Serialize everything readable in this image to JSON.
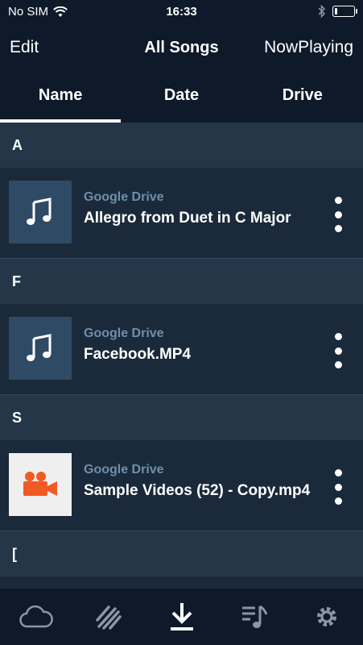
{
  "status": {
    "carrier": "No SIM",
    "time": "16:33"
  },
  "navbar": {
    "edit_label": "Edit",
    "title": "All Songs",
    "nowplaying_label": "NowPlaying"
  },
  "tabs": [
    {
      "label": "Name"
    },
    {
      "label": "Date"
    },
    {
      "label": "Drive"
    }
  ],
  "sections": [
    {
      "letter": "A",
      "items": [
        {
          "source": "Google Drive",
          "title": "Allegro from Duet in C Major",
          "icon": "music-note-icon"
        }
      ]
    },
    {
      "letter": "F",
      "items": [
        {
          "source": "Google Drive",
          "title": "Facebook.MP4",
          "icon": "music-note-icon"
        }
      ]
    },
    {
      "letter": "S",
      "items": [
        {
          "source": "Google Drive",
          "title": "Sample Videos (52) - Copy.mp4",
          "icon": "video-camera-icon"
        }
      ]
    },
    {
      "letter": "["
    }
  ],
  "tabbar": [
    {
      "icon": "cloud-icon"
    },
    {
      "icon": "stripes-icon"
    },
    {
      "icon": "download-icon"
    },
    {
      "icon": "playlist-icon"
    },
    {
      "icon": "gear-icon"
    }
  ],
  "colors": {
    "background": "#1b2a3a",
    "header": "#0e1a2a",
    "section": "#253649",
    "source_text": "#6f8ea9",
    "video_accent": "#f05a23"
  }
}
